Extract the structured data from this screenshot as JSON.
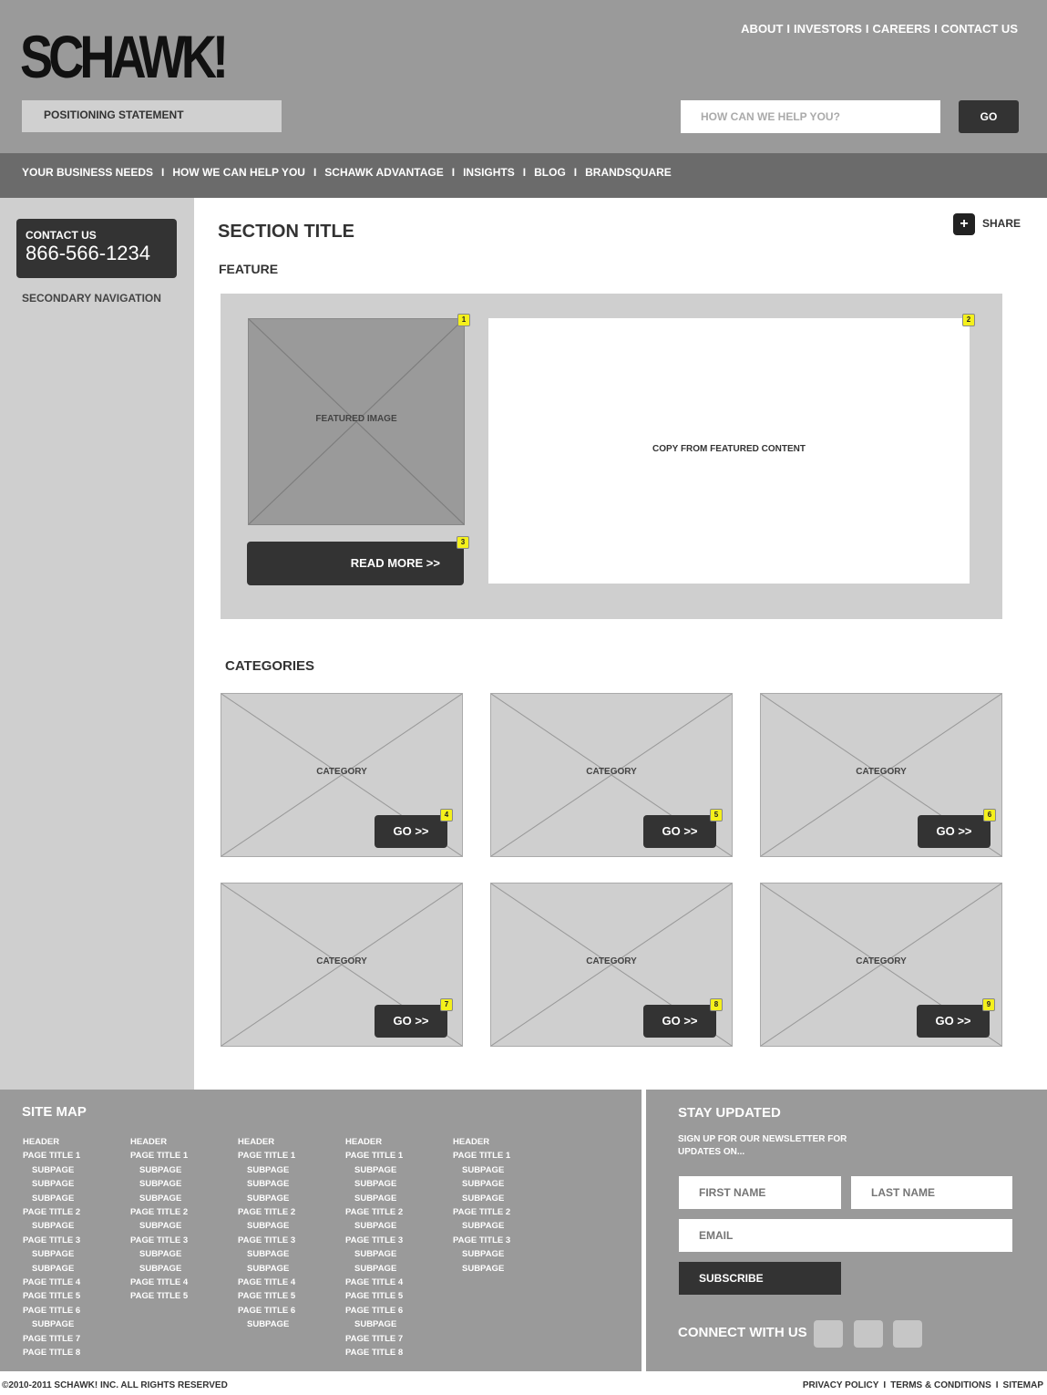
{
  "header": {
    "logo": "SCHAWK!",
    "top_links": [
      "ABOUT",
      "INVESTORS",
      "CAREERS",
      "CONTACT US"
    ],
    "positioning_statement": "POSITIONING STATEMENT",
    "search_placeholder": "HOW CAN WE HELP YOU?",
    "search_button": "GO"
  },
  "nav": {
    "items": [
      "YOUR BUSINESS NEEDS",
      "HOW WE CAN HELP YOU",
      "SCHAWK ADVANTAGE",
      "INSIGHTS",
      "BLOG",
      "BRANDSQUARE"
    ]
  },
  "sidebar": {
    "contact_label": "CONTACT US",
    "contact_phone": "866-566-1234",
    "secondary_nav": "SECONDARY NAVIGATION"
  },
  "main": {
    "section_title": "SECTION TITLE",
    "share_label": "SHARE",
    "feature_label": "FEATURE",
    "featured_image_label": "FEATURED IMAGE",
    "feature_copy": "COPY FROM FEATURED CONTENT",
    "read_more": "READ MORE >>",
    "badges": {
      "image": "1",
      "copy": "2",
      "read_more": "3"
    },
    "categories_label": "CATEGORIES",
    "categories": [
      {
        "label": "CATEGORY",
        "go": "GO >>",
        "badge": "4"
      },
      {
        "label": "CATEGORY",
        "go": "GO >>",
        "badge": "5"
      },
      {
        "label": "CATEGORY",
        "go": "GO >>",
        "badge": "6"
      },
      {
        "label": "CATEGORY",
        "go": "GO >>",
        "badge": "7"
      },
      {
        "label": "CATEGORY",
        "go": "GO >>",
        "badge": "8"
      },
      {
        "label": "CATEGORY",
        "go": "GO >>",
        "badge": "9"
      }
    ]
  },
  "footer": {
    "sitemap_title": "SITE MAP",
    "sitemap_columns": [
      [
        [
          "h",
          "HEADER"
        ],
        [
          "p",
          "PAGE TITLE 1"
        ],
        [
          "s",
          "SUBPAGE"
        ],
        [
          "s",
          "SUBPAGE"
        ],
        [
          "s",
          "SUBPAGE"
        ],
        [
          "p",
          "PAGE TITLE 2"
        ],
        [
          "s",
          "SUBPAGE"
        ],
        [
          "p",
          "PAGE TITLE 3"
        ],
        [
          "s",
          "SUBPAGE"
        ],
        [
          "s",
          "SUBPAGE"
        ],
        [
          "p",
          "PAGE TITLE 4"
        ],
        [
          "p",
          "PAGE TITLE 5"
        ],
        [
          "p",
          "PAGE TITLE 6"
        ],
        [
          "s",
          "SUBPAGE"
        ],
        [
          "p",
          "PAGE TITLE 7"
        ],
        [
          "p",
          "PAGE TITLE 8"
        ]
      ],
      [
        [
          "h",
          "HEADER"
        ],
        [
          "p",
          "PAGE TITLE 1"
        ],
        [
          "s",
          "SUBPAGE"
        ],
        [
          "s",
          "SUBPAGE"
        ],
        [
          "s",
          "SUBPAGE"
        ],
        [
          "p",
          "PAGE TITLE 2"
        ],
        [
          "s",
          "SUBPAGE"
        ],
        [
          "p",
          "PAGE TITLE 3"
        ],
        [
          "s",
          "SUBPAGE"
        ],
        [
          "s",
          "SUBPAGE"
        ],
        [
          "p",
          "PAGE TITLE 4"
        ],
        [
          "p",
          "PAGE TITLE 5"
        ]
      ],
      [
        [
          "h",
          "HEADER"
        ],
        [
          "p",
          "PAGE TITLE 1"
        ],
        [
          "s",
          "SUBPAGE"
        ],
        [
          "s",
          "SUBPAGE"
        ],
        [
          "s",
          "SUBPAGE"
        ],
        [
          "p",
          "PAGE TITLE 2"
        ],
        [
          "s",
          "SUBPAGE"
        ],
        [
          "p",
          "PAGE TITLE 3"
        ],
        [
          "s",
          "SUBPAGE"
        ],
        [
          "s",
          "SUBPAGE"
        ],
        [
          "p",
          "PAGE TITLE 4"
        ],
        [
          "p",
          "PAGE TITLE 5"
        ],
        [
          "p",
          "PAGE TITLE 6"
        ],
        [
          "s",
          "SUBPAGE"
        ]
      ],
      [
        [
          "h",
          "HEADER"
        ],
        [
          "p",
          "PAGE TITLE 1"
        ],
        [
          "s",
          "SUBPAGE"
        ],
        [
          "s",
          "SUBPAGE"
        ],
        [
          "s",
          "SUBPAGE"
        ],
        [
          "p",
          "PAGE TITLE 2"
        ],
        [
          "s",
          "SUBPAGE"
        ],
        [
          "p",
          "PAGE TITLE 3"
        ],
        [
          "s",
          "SUBPAGE"
        ],
        [
          "s",
          "SUBPAGE"
        ],
        [
          "p",
          "PAGE TITLE 4"
        ],
        [
          "p",
          "PAGE TITLE 5"
        ],
        [
          "p",
          "PAGE TITLE 6"
        ],
        [
          "s",
          "SUBPAGE"
        ],
        [
          "p",
          "PAGE TITLE 7"
        ],
        [
          "p",
          "PAGE TITLE 8"
        ]
      ],
      [
        [
          "h",
          "HEADER"
        ],
        [
          "p",
          "PAGE TITLE 1"
        ],
        [
          "s",
          "SUBPAGE"
        ],
        [
          "s",
          "SUBPAGE"
        ],
        [
          "s",
          "SUBPAGE"
        ],
        [
          "p",
          "PAGE TITLE 2"
        ],
        [
          "s",
          "SUBPAGE"
        ],
        [
          "p",
          "PAGE TITLE 3"
        ],
        [
          "s",
          "SUBPAGE"
        ],
        [
          "s",
          "SUBPAGE"
        ]
      ]
    ],
    "stay_title": "STAY UPDATED",
    "stay_sub": "SIGN UP FOR OUR NEWSLETTER FOR UPDATES ON...",
    "first_name_placeholder": "FIRST NAME",
    "last_name_placeholder": "LAST NAME",
    "email_placeholder": "EMAIL",
    "subscribe": "SUBSCRIBE",
    "connect": "CONNECT WITH US",
    "copyright": "©2010-2011 SCHAWK! INC. ALL RIGHTS RESERVED",
    "legal_links": [
      "PRIVACY POLICY",
      "TERMS & CONDITIONS",
      "SITEMAP"
    ]
  }
}
